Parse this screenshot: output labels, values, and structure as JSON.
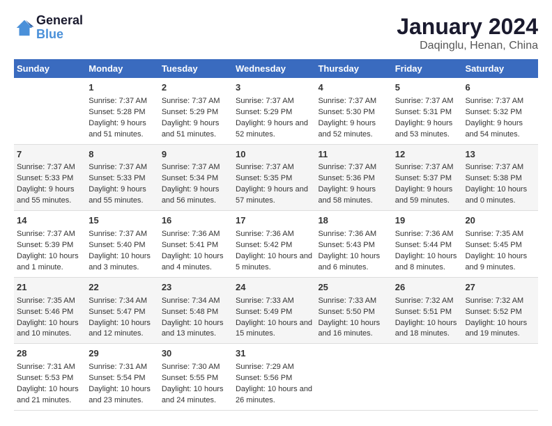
{
  "header": {
    "logo_line1": "General",
    "logo_line2": "Blue",
    "main_title": "January 2024",
    "subtitle": "Daqinglu, Henan, China"
  },
  "weekdays": [
    "Sunday",
    "Monday",
    "Tuesday",
    "Wednesday",
    "Thursday",
    "Friday",
    "Saturday"
  ],
  "weeks": [
    [
      null,
      {
        "day": 1,
        "sunrise": "7:37 AM",
        "sunset": "5:28 PM",
        "daylight": "9 hours and 51 minutes."
      },
      {
        "day": 2,
        "sunrise": "7:37 AM",
        "sunset": "5:29 PM",
        "daylight": "9 hours and 51 minutes."
      },
      {
        "day": 3,
        "sunrise": "7:37 AM",
        "sunset": "5:29 PM",
        "daylight": "9 hours and 52 minutes."
      },
      {
        "day": 4,
        "sunrise": "7:37 AM",
        "sunset": "5:30 PM",
        "daylight": "9 hours and 52 minutes."
      },
      {
        "day": 5,
        "sunrise": "7:37 AM",
        "sunset": "5:31 PM",
        "daylight": "9 hours and 53 minutes."
      },
      {
        "day": 6,
        "sunrise": "7:37 AM",
        "sunset": "5:32 PM",
        "daylight": "9 hours and 54 minutes."
      }
    ],
    [
      {
        "day": 7,
        "sunrise": "7:37 AM",
        "sunset": "5:33 PM",
        "daylight": "9 hours and 55 minutes."
      },
      {
        "day": 8,
        "sunrise": "7:37 AM",
        "sunset": "5:33 PM",
        "daylight": "9 hours and 55 minutes."
      },
      {
        "day": 9,
        "sunrise": "7:37 AM",
        "sunset": "5:34 PM",
        "daylight": "9 hours and 56 minutes."
      },
      {
        "day": 10,
        "sunrise": "7:37 AM",
        "sunset": "5:35 PM",
        "daylight": "9 hours and 57 minutes."
      },
      {
        "day": 11,
        "sunrise": "7:37 AM",
        "sunset": "5:36 PM",
        "daylight": "9 hours and 58 minutes."
      },
      {
        "day": 12,
        "sunrise": "7:37 AM",
        "sunset": "5:37 PM",
        "daylight": "9 hours and 59 minutes."
      },
      {
        "day": 13,
        "sunrise": "7:37 AM",
        "sunset": "5:38 PM",
        "daylight": "10 hours and 0 minutes."
      }
    ],
    [
      {
        "day": 14,
        "sunrise": "7:37 AM",
        "sunset": "5:39 PM",
        "daylight": "10 hours and 1 minute."
      },
      {
        "day": 15,
        "sunrise": "7:37 AM",
        "sunset": "5:40 PM",
        "daylight": "10 hours and 3 minutes."
      },
      {
        "day": 16,
        "sunrise": "7:36 AM",
        "sunset": "5:41 PM",
        "daylight": "10 hours and 4 minutes."
      },
      {
        "day": 17,
        "sunrise": "7:36 AM",
        "sunset": "5:42 PM",
        "daylight": "10 hours and 5 minutes."
      },
      {
        "day": 18,
        "sunrise": "7:36 AM",
        "sunset": "5:43 PM",
        "daylight": "10 hours and 6 minutes."
      },
      {
        "day": 19,
        "sunrise": "7:36 AM",
        "sunset": "5:44 PM",
        "daylight": "10 hours and 8 minutes."
      },
      {
        "day": 20,
        "sunrise": "7:35 AM",
        "sunset": "5:45 PM",
        "daylight": "10 hours and 9 minutes."
      }
    ],
    [
      {
        "day": 21,
        "sunrise": "7:35 AM",
        "sunset": "5:46 PM",
        "daylight": "10 hours and 10 minutes."
      },
      {
        "day": 22,
        "sunrise": "7:34 AM",
        "sunset": "5:47 PM",
        "daylight": "10 hours and 12 minutes."
      },
      {
        "day": 23,
        "sunrise": "7:34 AM",
        "sunset": "5:48 PM",
        "daylight": "10 hours and 13 minutes."
      },
      {
        "day": 24,
        "sunrise": "7:33 AM",
        "sunset": "5:49 PM",
        "daylight": "10 hours and 15 minutes."
      },
      {
        "day": 25,
        "sunrise": "7:33 AM",
        "sunset": "5:50 PM",
        "daylight": "10 hours and 16 minutes."
      },
      {
        "day": 26,
        "sunrise": "7:32 AM",
        "sunset": "5:51 PM",
        "daylight": "10 hours and 18 minutes."
      },
      {
        "day": 27,
        "sunrise": "7:32 AM",
        "sunset": "5:52 PM",
        "daylight": "10 hours and 19 minutes."
      }
    ],
    [
      {
        "day": 28,
        "sunrise": "7:31 AM",
        "sunset": "5:53 PM",
        "daylight": "10 hours and 21 minutes."
      },
      {
        "day": 29,
        "sunrise": "7:31 AM",
        "sunset": "5:54 PM",
        "daylight": "10 hours and 23 minutes."
      },
      {
        "day": 30,
        "sunrise": "7:30 AM",
        "sunset": "5:55 PM",
        "daylight": "10 hours and 24 minutes."
      },
      {
        "day": 31,
        "sunrise": "7:29 AM",
        "sunset": "5:56 PM",
        "daylight": "10 hours and 26 minutes."
      },
      null,
      null,
      null
    ]
  ]
}
